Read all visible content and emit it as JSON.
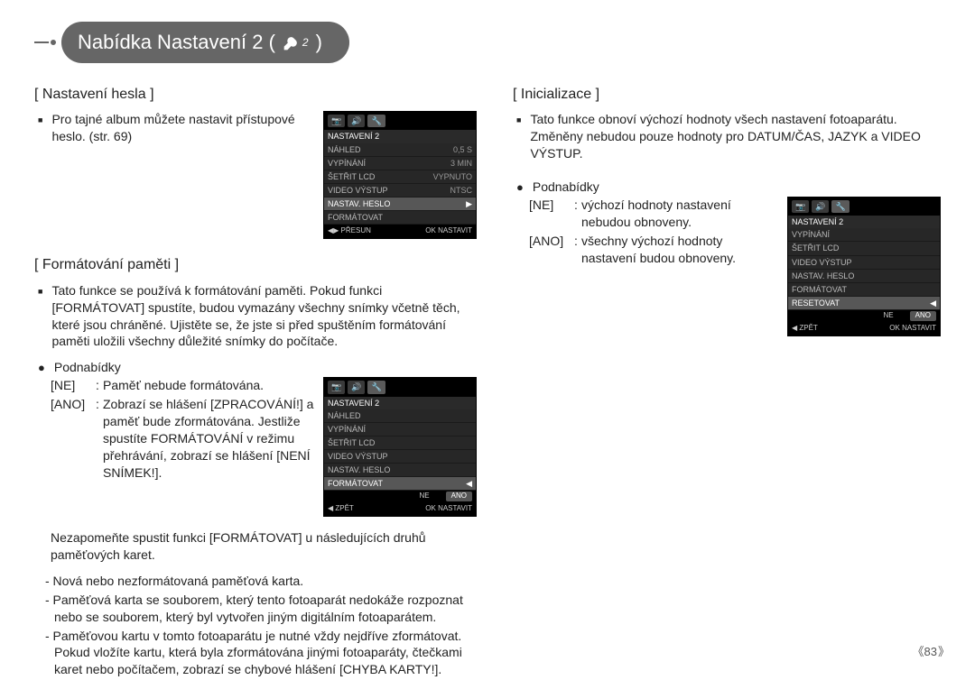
{
  "title": {
    "text": "Nabídka Nastavení 2 (",
    "close": ")"
  },
  "left": {
    "sec1_title": "[ Nastavení hesla ]",
    "sec1_text": "Pro tajné album můžete nastavit přístupové heslo. (str. 69)",
    "sec2_title": "[ Formátování paměti ]",
    "sec2_text": "Tato funkce se používá k formátování paměti. Pokud funkci [FORMÁTOVAT] spustíte, budou vymazány všechny snímky včetně těch, které jsou chráněné. Ujistěte se, že jste si před spuštěním formátování paměti uložili všechny důležité snímky do počítače.",
    "sub_label": "Podnabídky",
    "ne_label": "[NE]",
    "ano_label": "[ANO]",
    "ne_text": "Paměť nebude formátována.",
    "ano_text": "Zobrazí se hlášení [ZPRACOVÁNÍ!] a paměť bude zformátována. Jestliže spustíte FORMÁTOVÁNÍ v režimu přehrávání, zobrazí se hlášení [NENÍ SNÍMEK!].",
    "warn": "Nezapomeňte spustit funkci [FORMÁTOVAT] u následujících druhů paměťových karet.",
    "li1": "- Nová nebo nezformátovaná paměťová karta.",
    "li2": "- Paměťová karta se souborem, který tento fotoaparát nedokáže rozpoznat nebo se souborem, který byl vytvořen jiným digitálním fotoaparátem.",
    "li3": "- Paměťovou kartu v tomto fotoaparátu je nutné vždy nejdříve zformátovat. Pokud vložíte kartu, která byla zformátována jinými fotoaparáty, čtečkami karet nebo počítačem, zobrazí se chybové hlášení [CHYBA KARTY!]."
  },
  "right": {
    "sec1_title": "[ Inicializace ]",
    "sec1_text": "Tato funkce obnoví výchozí hodnoty všech nastavení fotoaparátu. Změněny nebudou pouze hodnoty pro DATUM/ČAS, JAZYK a VIDEO VÝSTUP.",
    "sub_label": "Podnabídky",
    "ne_label": "[NE]",
    "ano_label": "[ANO]",
    "ne_text": "výchozí hodnoty nastavení nebudou obnoveny.",
    "ano_text": "všechny výchozí hodnoty nastavení budou obnoveny."
  },
  "lcd": {
    "heading": "NASTAVENÍ 2",
    "r1": "NÁHLED",
    "v1": "0,5 S",
    "r2": "VYPÍNÁNÍ",
    "v2": "3 MIN",
    "r3": "ŠETŘIT LCD",
    "v3": "VYPNUTO",
    "r4": "VIDEO VÝSTUP",
    "v4": "NTSC",
    "r5": "NASTAV. HESLO",
    "r6": "FORMÁTOVAT",
    "r7": "RESETOVAT",
    "opt_ne": "NE",
    "opt_ano": "ANO",
    "foot_left_presun": "◀▶ PŘESUN",
    "foot_left_zpet": "◀  ZPĚT",
    "foot_right": "OK  NASTAVIT"
  },
  "page_num": "83"
}
